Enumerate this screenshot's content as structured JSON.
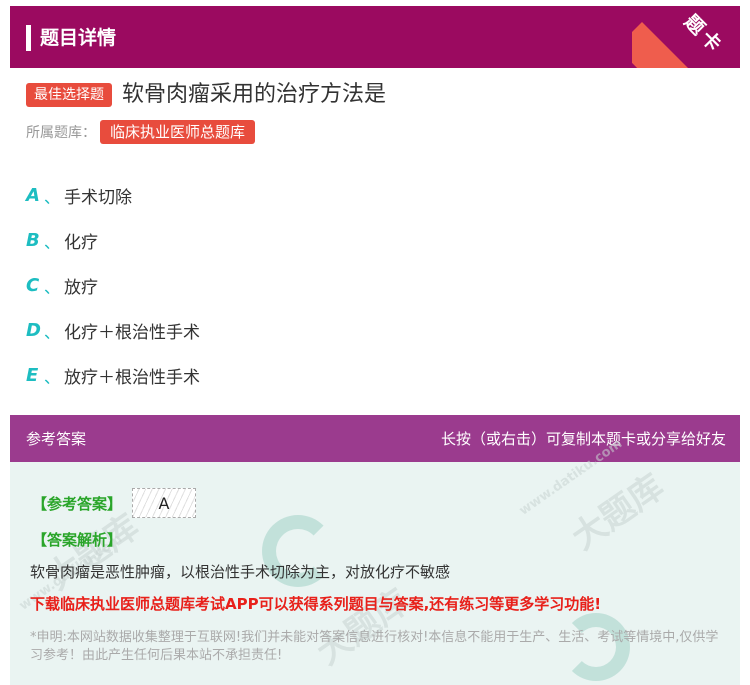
{
  "header": {
    "title": "题目详情",
    "corner_label": "题卡"
  },
  "question": {
    "type_badge": "最佳选择题",
    "text": "软骨肉瘤采用的治疗方法是",
    "bank_label": "所属题库：",
    "bank_name": "临床执业医师总题库"
  },
  "options": [
    {
      "letter": "A",
      "sep": "、",
      "text": "手术切除"
    },
    {
      "letter": "B",
      "sep": "、",
      "text": "化疗"
    },
    {
      "letter": "C",
      "sep": "、",
      "text": "放疗"
    },
    {
      "letter": "D",
      "sep": "、",
      "text": "化疗＋根治性手术"
    },
    {
      "letter": "E",
      "sep": "、",
      "text": "放疗＋根治性手术"
    }
  ],
  "answer_panel": {
    "title": "参考答案",
    "share_hint": "长按（或右击）可复制本题卡或分享给好友",
    "answer_label": "【参考答案】",
    "answer_value": "A",
    "analysis_label": "【答案解析】",
    "analysis_text": "软骨肉瘤是恶性肿瘤，以根治性手术切除为主，对放化疗不敏感",
    "promo_text": "下载临床执业医师总题库考试APP可以获得系列题目与答案,还有练习等更多学习功能!",
    "disclaimer": "*申明:本网站数据收集整理于互联网!我们并未能对答案信息进行核对!本信息不能用于生产、生活、考试等情境中,仅供学习参考！由此产生任何后果本站不承担责任!"
  },
  "watermark": {
    "big": "大题库",
    "small": "www.datiku.com"
  },
  "colors": {
    "header_bg": "#9b0a60",
    "answer_header_bg": "#9b3b8e",
    "badge_red": "#e84c3d",
    "option_letter": "#1dbdc1",
    "answer_green": "#2aa52a",
    "promo_red": "#e8201a",
    "panel_bg": "#eaf4f2"
  }
}
